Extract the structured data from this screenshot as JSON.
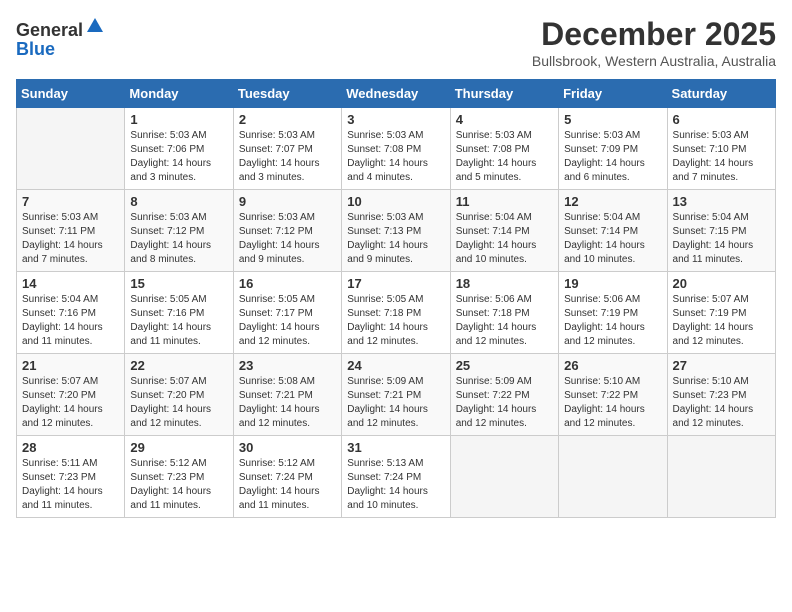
{
  "header": {
    "logo_line1": "General",
    "logo_line2": "Blue",
    "month_title": "December 2025",
    "location": "Bullsbrook, Western Australia, Australia"
  },
  "days_of_week": [
    "Sunday",
    "Monday",
    "Tuesday",
    "Wednesday",
    "Thursday",
    "Friday",
    "Saturday"
  ],
  "weeks": [
    [
      {
        "day": "",
        "info": ""
      },
      {
        "day": "1",
        "info": "Sunrise: 5:03 AM\nSunset: 7:06 PM\nDaylight: 14 hours\nand 3 minutes."
      },
      {
        "day": "2",
        "info": "Sunrise: 5:03 AM\nSunset: 7:07 PM\nDaylight: 14 hours\nand 3 minutes."
      },
      {
        "day": "3",
        "info": "Sunrise: 5:03 AM\nSunset: 7:08 PM\nDaylight: 14 hours\nand 4 minutes."
      },
      {
        "day": "4",
        "info": "Sunrise: 5:03 AM\nSunset: 7:08 PM\nDaylight: 14 hours\nand 5 minutes."
      },
      {
        "day": "5",
        "info": "Sunrise: 5:03 AM\nSunset: 7:09 PM\nDaylight: 14 hours\nand 6 minutes."
      },
      {
        "day": "6",
        "info": "Sunrise: 5:03 AM\nSunset: 7:10 PM\nDaylight: 14 hours\nand 7 minutes."
      }
    ],
    [
      {
        "day": "7",
        "info": "Sunrise: 5:03 AM\nSunset: 7:11 PM\nDaylight: 14 hours\nand 7 minutes."
      },
      {
        "day": "8",
        "info": "Sunrise: 5:03 AM\nSunset: 7:12 PM\nDaylight: 14 hours\nand 8 minutes."
      },
      {
        "day": "9",
        "info": "Sunrise: 5:03 AM\nSunset: 7:12 PM\nDaylight: 14 hours\nand 9 minutes."
      },
      {
        "day": "10",
        "info": "Sunrise: 5:03 AM\nSunset: 7:13 PM\nDaylight: 14 hours\nand 9 minutes."
      },
      {
        "day": "11",
        "info": "Sunrise: 5:04 AM\nSunset: 7:14 PM\nDaylight: 14 hours\nand 10 minutes."
      },
      {
        "day": "12",
        "info": "Sunrise: 5:04 AM\nSunset: 7:14 PM\nDaylight: 14 hours\nand 10 minutes."
      },
      {
        "day": "13",
        "info": "Sunrise: 5:04 AM\nSunset: 7:15 PM\nDaylight: 14 hours\nand 11 minutes."
      }
    ],
    [
      {
        "day": "14",
        "info": "Sunrise: 5:04 AM\nSunset: 7:16 PM\nDaylight: 14 hours\nand 11 minutes."
      },
      {
        "day": "15",
        "info": "Sunrise: 5:05 AM\nSunset: 7:16 PM\nDaylight: 14 hours\nand 11 minutes."
      },
      {
        "day": "16",
        "info": "Sunrise: 5:05 AM\nSunset: 7:17 PM\nDaylight: 14 hours\nand 12 minutes."
      },
      {
        "day": "17",
        "info": "Sunrise: 5:05 AM\nSunset: 7:18 PM\nDaylight: 14 hours\nand 12 minutes."
      },
      {
        "day": "18",
        "info": "Sunrise: 5:06 AM\nSunset: 7:18 PM\nDaylight: 14 hours\nand 12 minutes."
      },
      {
        "day": "19",
        "info": "Sunrise: 5:06 AM\nSunset: 7:19 PM\nDaylight: 14 hours\nand 12 minutes."
      },
      {
        "day": "20",
        "info": "Sunrise: 5:07 AM\nSunset: 7:19 PM\nDaylight: 14 hours\nand 12 minutes."
      }
    ],
    [
      {
        "day": "21",
        "info": "Sunrise: 5:07 AM\nSunset: 7:20 PM\nDaylight: 14 hours\nand 12 minutes."
      },
      {
        "day": "22",
        "info": "Sunrise: 5:07 AM\nSunset: 7:20 PM\nDaylight: 14 hours\nand 12 minutes."
      },
      {
        "day": "23",
        "info": "Sunrise: 5:08 AM\nSunset: 7:21 PM\nDaylight: 14 hours\nand 12 minutes."
      },
      {
        "day": "24",
        "info": "Sunrise: 5:09 AM\nSunset: 7:21 PM\nDaylight: 14 hours\nand 12 minutes."
      },
      {
        "day": "25",
        "info": "Sunrise: 5:09 AM\nSunset: 7:22 PM\nDaylight: 14 hours\nand 12 minutes."
      },
      {
        "day": "26",
        "info": "Sunrise: 5:10 AM\nSunset: 7:22 PM\nDaylight: 14 hours\nand 12 minutes."
      },
      {
        "day": "27",
        "info": "Sunrise: 5:10 AM\nSunset: 7:23 PM\nDaylight: 14 hours\nand 12 minutes."
      }
    ],
    [
      {
        "day": "28",
        "info": "Sunrise: 5:11 AM\nSunset: 7:23 PM\nDaylight: 14 hours\nand 11 minutes."
      },
      {
        "day": "29",
        "info": "Sunrise: 5:12 AM\nSunset: 7:23 PM\nDaylight: 14 hours\nand 11 minutes."
      },
      {
        "day": "30",
        "info": "Sunrise: 5:12 AM\nSunset: 7:24 PM\nDaylight: 14 hours\nand 11 minutes."
      },
      {
        "day": "31",
        "info": "Sunrise: 5:13 AM\nSunset: 7:24 PM\nDaylight: 14 hours\nand 10 minutes."
      },
      {
        "day": "",
        "info": ""
      },
      {
        "day": "",
        "info": ""
      },
      {
        "day": "",
        "info": ""
      }
    ]
  ]
}
